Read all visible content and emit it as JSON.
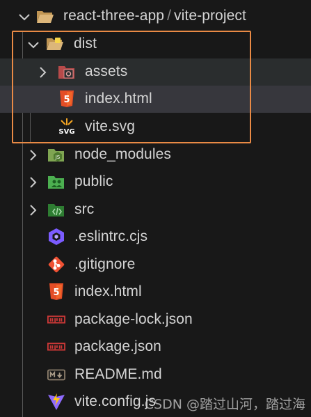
{
  "root": {
    "name": "react-three-app",
    "separator": "/",
    "sub": "vite-project"
  },
  "colors": {
    "folder": "#dcb67a",
    "html": "#e44d26",
    "npm": "#cb3837",
    "git": "#f05133",
    "eslint": "#7b5cff",
    "vite": "#8f6bff",
    "highlight": "#e98a45",
    "selection": "#37373d"
  },
  "tree": {
    "dist": {
      "label": "dist",
      "icon": "folder-open-dist-icon"
    },
    "assets": {
      "label": "assets",
      "icon": "folder-assets-icon"
    },
    "dist_index": {
      "label": "index.html",
      "icon": "html5-icon"
    },
    "vite_svg": {
      "label": "vite.svg",
      "icon": "svg-icon"
    },
    "node_modules": {
      "label": "node_modules",
      "icon": "folder-node-icon"
    },
    "public": {
      "label": "public",
      "icon": "folder-public-icon"
    },
    "src": {
      "label": "src",
      "icon": "folder-src-icon"
    },
    "eslintrc": {
      "label": ".eslintrc.cjs",
      "icon": "eslint-icon"
    },
    "gitignore": {
      "label": ".gitignore",
      "icon": "git-icon"
    },
    "index_html": {
      "label": "index.html",
      "icon": "html5-icon"
    },
    "package_lock": {
      "label": "package-lock.json",
      "icon": "npm-icon"
    },
    "package_json": {
      "label": "package.json",
      "icon": "npm-icon"
    },
    "readme": {
      "label": "README.md",
      "icon": "markdown-icon"
    },
    "vite_config": {
      "label": "vite.config.js",
      "icon": "vite-icon"
    }
  },
  "watermark": "CSDN @踏过山河，踏过海"
}
